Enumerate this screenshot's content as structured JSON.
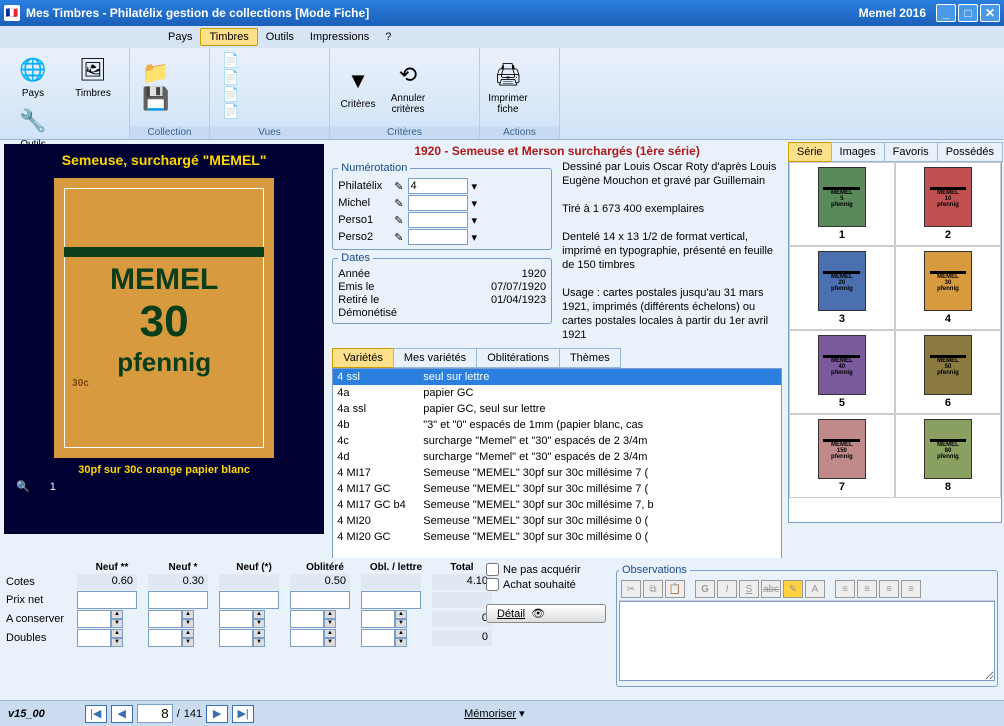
{
  "window": {
    "title": "Mes Timbres - Philatélix gestion de collections [Mode Fiche]",
    "right_label": "Memel 2016"
  },
  "menu": [
    "Pays",
    "Timbres",
    "Outils",
    "Impressions",
    "?"
  ],
  "menu_active": "Timbres",
  "ribbon": {
    "left_group": [
      {
        "icon": "🌐",
        "label": "Pays"
      },
      {
        "icon": "🖼",
        "label": "Timbres"
      },
      {
        "icon": "🔧",
        "label": "Outils"
      },
      {
        "icon": "🖨",
        "label": "Impressions"
      }
    ],
    "collection": {
      "label": "Collection"
    },
    "vues": {
      "label": "Vues"
    },
    "criteres": {
      "label": "Critères",
      "items": [
        {
          "icon": "▼",
          "label": "Critères"
        },
        {
          "icon": "⟲",
          "label": "Annuler\ncritères"
        }
      ]
    },
    "actions": {
      "label": "Actions",
      "items": [
        {
          "icon": "🖨",
          "label": "Imprimer\nfiche"
        }
      ]
    }
  },
  "stamp": {
    "title": "Semeuse, surchargé \"MEMEL\"",
    "overprint1": "MEMEL",
    "overprint2": "30",
    "overprint3": "pfennig",
    "face": "30c",
    "caption": "30pf sur 30c orange papier blanc",
    "zoom": "1"
  },
  "record_title": "1920 - Semeuse et Merson surchargés (1ère série)",
  "numerotation": {
    "legend": "Numérotation",
    "fields": [
      {
        "label": "Philatélix",
        "value": "4"
      },
      {
        "label": "Michel",
        "value": ""
      },
      {
        "label": "Perso1",
        "value": ""
      },
      {
        "label": "Perso2",
        "value": ""
      }
    ]
  },
  "dates": {
    "legend": "Dates",
    "rows": [
      {
        "label": "Année",
        "value": "1920"
      },
      {
        "label": "Emis le",
        "value": "07/07/1920"
      },
      {
        "label": "Retiré le",
        "value": "01/04/1923"
      },
      {
        "label": "Démonétisé",
        "value": ""
      }
    ]
  },
  "desc": {
    "line1": "Dessiné par Louis Oscar Roty d'après Louis Eugène Mouchon et gravé par Guillemain",
    "line2": "Tiré à 1 673 400 exemplaires",
    "line3": "Dentelé 14 x 13 1/2 de format vertical, imprimé en typographie, présenté en feuille de 150 timbres",
    "line4": "Usage :  cartes postales jusqu'au 31 mars 1921, imprimés (différents échelons) ou cartes postales locales à partir du 1er avril 1921"
  },
  "mid_tabs": [
    "Variétés",
    "Mes variétés",
    "Oblitérations",
    "Thèmes"
  ],
  "mid_tab_active": "Variétés",
  "varieties": [
    {
      "code": "4 ssl",
      "desc": "seul sur lettre",
      "sel": true
    },
    {
      "code": "4a",
      "desc": "papier GC"
    },
    {
      "code": "4a ssl",
      "desc": "papier GC, seul sur lettre"
    },
    {
      "code": "4b",
      "desc": "\"3\" et \"0\" espacés de 1mm (papier blanc, cas"
    },
    {
      "code": "4c",
      "desc": "surcharge \"Memel\" et \"30\" espacés de 2 3/4m"
    },
    {
      "code": "4d",
      "desc": "surcharge \"Memel\" et \"30\" espacés de 2 3/4m"
    },
    {
      "code": "4 MI17",
      "desc": "Semeuse \"MEMEL\" 30pf sur 30c millésime 7 ("
    },
    {
      "code": "4 MI17 GC",
      "desc": "Semeuse \"MEMEL\" 30pf sur 30c millésime 7 ("
    },
    {
      "code": "4 MI17 GC b4",
      "desc": "Semeuse \"MEMEL\" 30pf sur 30c millésime 7, b"
    },
    {
      "code": "4 MI20",
      "desc": "Semeuse \"MEMEL\" 30pf sur 30c millésime 0 ("
    },
    {
      "code": "4 MI20 GC",
      "desc": "Semeuse \"MEMEL\" 30pf sur 30c millésime 0 ("
    }
  ],
  "right_tabs": [
    "Série",
    "Images",
    "Favoris",
    "Possédés"
  ],
  "right_tab_active": "Série",
  "thumbs": [
    {
      "n": "1",
      "c": "#5a8a5a",
      "t": "5"
    },
    {
      "n": "2",
      "c": "#c05050",
      "t": "10"
    },
    {
      "n": "3",
      "c": "#4a70b0",
      "t": "20"
    },
    {
      "n": "4",
      "c": "#d89a3e",
      "t": "30"
    },
    {
      "n": "5",
      "c": "#7a5a9a",
      "t": "40"
    },
    {
      "n": "6",
      "c": "#8a7a40",
      "t": "50"
    },
    {
      "n": "7",
      "c": "#c08a8a",
      "t": "150"
    },
    {
      "n": "8",
      "c": "#8aa060",
      "t": "80"
    }
  ],
  "price": {
    "headers": [
      "Neuf **",
      "Neuf *",
      "Neuf (*)",
      "Oblitéré",
      "Obl. / lettre",
      "Total"
    ],
    "rows": [
      {
        "label": "Cotes",
        "vals": [
          "0.60",
          "0.30",
          "",
          "0.50",
          "",
          "4.10"
        ],
        "type": "val"
      },
      {
        "label": "Prix net",
        "vals": [
          "",
          "",
          "",
          "",
          "",
          ""
        ],
        "type": "input"
      },
      {
        "label": "A conserver",
        "vals": [
          "",
          "",
          "",
          "",
          "",
          "0"
        ],
        "type": "step"
      },
      {
        "label": "Doubles",
        "vals": [
          "",
          "",
          "",
          "",
          "",
          "0"
        ],
        "type": "step"
      }
    ]
  },
  "chk": {
    "acq": "Ne pas acquérir",
    "souhaite": "Achat souhaité"
  },
  "detail": "Détail",
  "obs": {
    "legend": "Observations"
  },
  "footer": {
    "ver": "v15_00",
    "page": "8",
    "total": "141",
    "memo": "Mémoriser"
  }
}
